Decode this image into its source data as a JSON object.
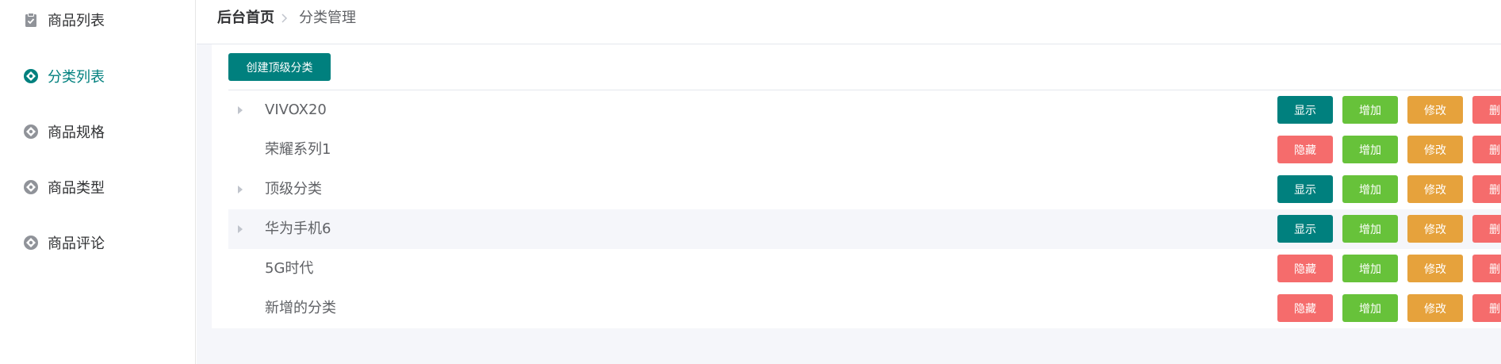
{
  "colors": {
    "accent": "#00807e",
    "add": "#67c23a",
    "edit": "#e6a23c",
    "danger": "#f56c6c"
  },
  "sidebar": {
    "items": [
      {
        "label": "商品列表",
        "icon": "clipboard-check-icon",
        "active": false
      },
      {
        "label": "分类列表",
        "icon": "aperture-icon",
        "active": true
      },
      {
        "label": "商品规格",
        "icon": "aperture-icon",
        "active": false
      },
      {
        "label": "商品类型",
        "icon": "aperture-icon",
        "active": false
      },
      {
        "label": "商品评论",
        "icon": "aperture-icon",
        "active": false
      }
    ]
  },
  "breadcrumb": {
    "home": "后台首页",
    "current": "分类管理"
  },
  "toolbar": {
    "create_label": "创建顶级分类"
  },
  "categories": [
    {
      "name": "VIVOX20",
      "expandable": true,
      "toggle": "显示",
      "add": "增加",
      "edit": "修改",
      "delete": "删除"
    },
    {
      "name": "荣耀系列1",
      "expandable": false,
      "toggle": "隐藏",
      "add": "增加",
      "edit": "修改",
      "delete": "删除"
    },
    {
      "name": "顶级分类",
      "expandable": true,
      "toggle": "显示",
      "add": "增加",
      "edit": "修改",
      "delete": "删除"
    },
    {
      "name": "华为手机6",
      "expandable": true,
      "toggle": "显示",
      "add": "增加",
      "edit": "修改",
      "delete": "删除"
    },
    {
      "name": "5G时代",
      "expandable": false,
      "toggle": "隐藏",
      "add": "增加",
      "edit": "修改",
      "delete": "删除"
    },
    {
      "name": "新增的分类",
      "expandable": false,
      "toggle": "隐藏",
      "add": "增加",
      "edit": "修改",
      "delete": "删除"
    }
  ]
}
